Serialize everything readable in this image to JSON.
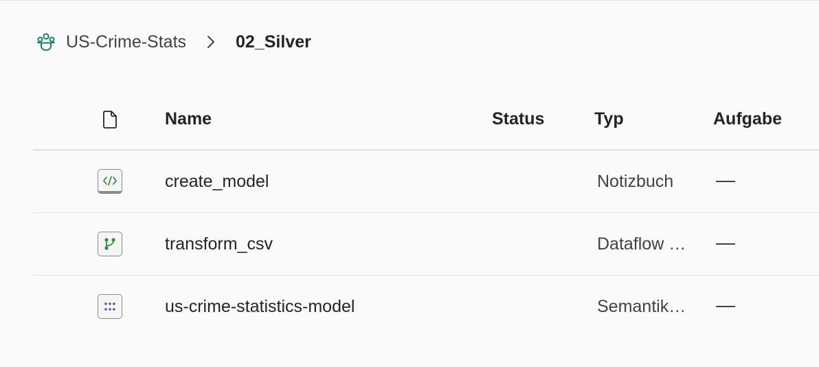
{
  "breadcrumb": {
    "workspace": "US-Crime-Stats",
    "current": "02_Silver",
    "workspace_icon": "workspace-icon",
    "separator_icon": "chevron-right-icon"
  },
  "table": {
    "columns": {
      "type_icon": "file-icon",
      "name": "Name",
      "status": "Status",
      "type": "Typ",
      "task": "Aufgabe"
    },
    "rows": [
      {
        "icon": "notebook-icon",
        "name": "create_model",
        "status": "",
        "type": "Notizbuch",
        "task": "—"
      },
      {
        "icon": "dataflow-icon",
        "name": "transform_csv",
        "status": "",
        "type": "Dataflow …",
        "task": "—"
      },
      {
        "icon": "semantic-model-icon",
        "name": "us-crime-statistics-model",
        "status": "",
        "type": "Semantik…",
        "task": "—"
      }
    ]
  },
  "colors": {
    "workspace_icon": "#1f7a6b",
    "notebook_accent": "#2f7d32",
    "dataflow_accent": "#3a8a3e",
    "semantic_accent": "#5b4fa8"
  }
}
